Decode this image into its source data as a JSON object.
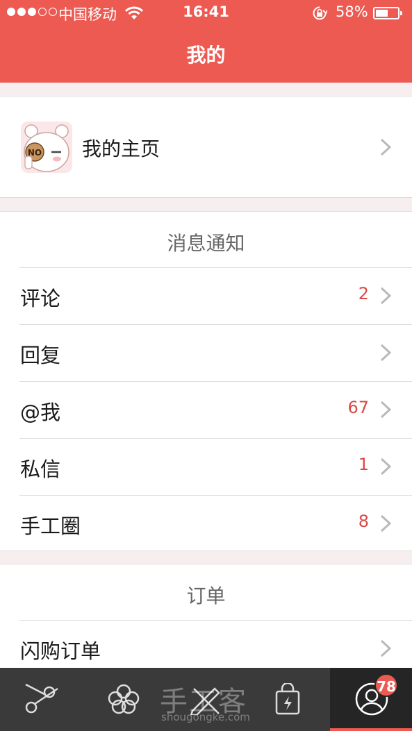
{
  "status_bar": {
    "carrier": "中国移动",
    "time": "16:41",
    "battery_percent": "58%",
    "battery_level": 0.58,
    "signal_dots_on": 3,
    "signal_dots_total": 5
  },
  "nav": {
    "title": "我的"
  },
  "profile": {
    "homepage_label": "我的主页"
  },
  "notifications": {
    "section_title": "消息通知",
    "items": [
      {
        "label": "评论",
        "count": "2"
      },
      {
        "label": "回复",
        "count": ""
      },
      {
        "label": "@我",
        "count": "67"
      },
      {
        "label": "私信",
        "count": "1"
      },
      {
        "label": "手工圈",
        "count": "8"
      }
    ]
  },
  "orders": {
    "section_title": "订单",
    "items": [
      {
        "label": "闪购订单",
        "count": ""
      }
    ]
  },
  "tabbar": {
    "tabs": [
      {
        "icon": "scissors-icon"
      },
      {
        "icon": "flower-icon"
      },
      {
        "icon": "pencil-ruler-icon"
      },
      {
        "icon": "shopping-bag-icon"
      },
      {
        "icon": "profile-icon",
        "active": true,
        "badge": "78"
      }
    ]
  },
  "watermark": {
    "text": "手工客",
    "sub": "shougongke.com"
  },
  "colors": {
    "accent": "#ec5a52",
    "count_red": "#d94a46",
    "tabbar_bg": "#3a3a3a",
    "page_bg": "#f7eef0"
  }
}
